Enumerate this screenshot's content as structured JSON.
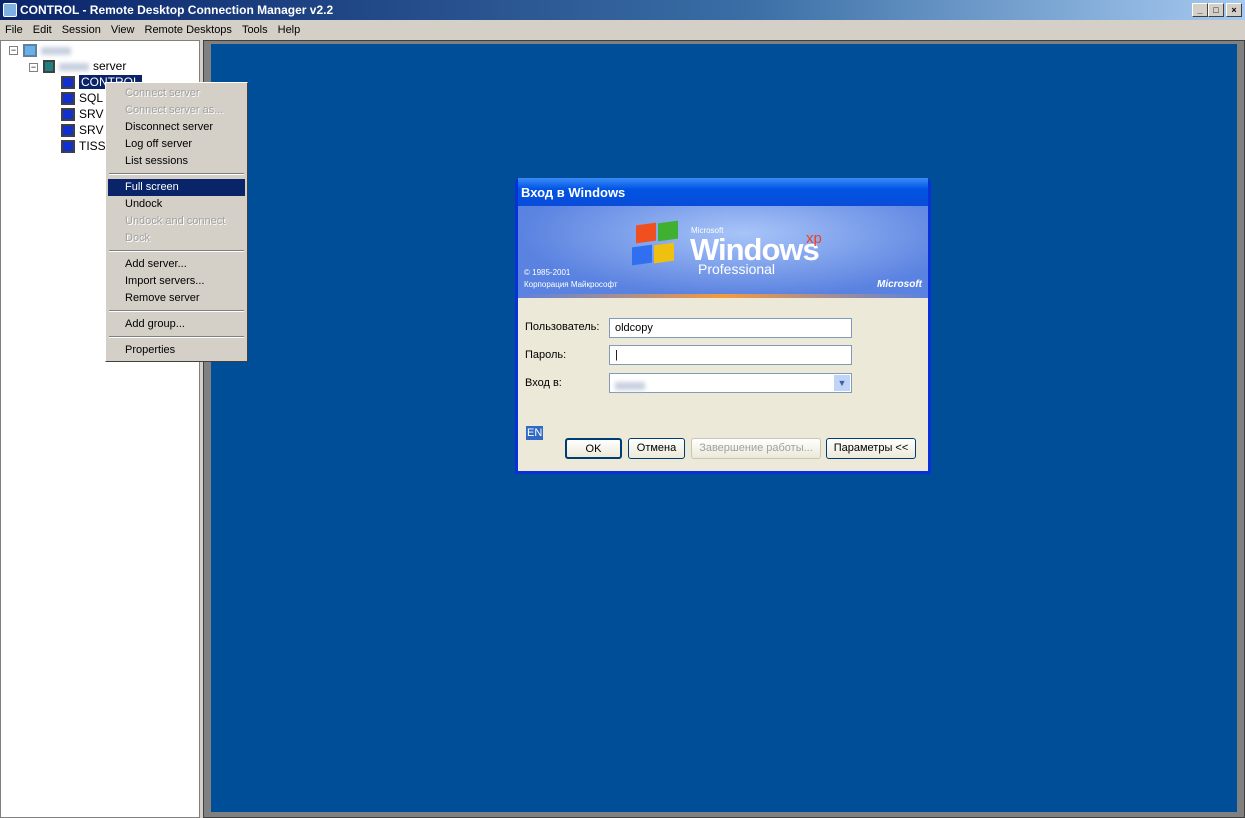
{
  "window": {
    "title": "CONTROL - Remote Desktop Connection Manager v2.2",
    "controls": [
      "_",
      "□",
      "×"
    ]
  },
  "menu": [
    "File",
    "Edit",
    "Session",
    "View",
    "Remote Desktops",
    "Tools",
    "Help"
  ],
  "tree": {
    "group_suffix": "server",
    "servers": [
      "CONTROL",
      "SQL",
      "SRV",
      "SRV",
      "TISS"
    ]
  },
  "context_menu": [
    {
      "label": "Connect server",
      "disabled": true
    },
    {
      "label": "Connect server as...",
      "disabled": true
    },
    {
      "label": "Disconnect server"
    },
    {
      "label": "Log off server"
    },
    {
      "label": "List sessions"
    },
    {
      "sep": true
    },
    {
      "label": "Full screen",
      "highlighted": true
    },
    {
      "label": "Undock"
    },
    {
      "label": "Undock and connect",
      "disabled": true
    },
    {
      "label": "Dock",
      "disabled": true
    },
    {
      "sep": true
    },
    {
      "label": "Add server..."
    },
    {
      "label": "Import servers..."
    },
    {
      "label": "Remove server"
    },
    {
      "sep": true
    },
    {
      "label": "Add group..."
    },
    {
      "sep": true
    },
    {
      "label": "Properties"
    }
  ],
  "login": {
    "title": "Вход в Windows",
    "brand": {
      "microsoft_small": "Microsoft",
      "windows": "Windows",
      "xp": "xp",
      "edition": "Professional",
      "copyright": "© 1985-2001",
      "corp": "Корпорация Майкрософт",
      "microsoft": "Microsoft"
    },
    "user_label": "Пользователь:",
    "user_value": "oldcopy",
    "password_label": "Пароль:",
    "password_value": "|",
    "domain_label": "Вход в:",
    "lang": "EN",
    "ok": "OK",
    "cancel": "Отмена",
    "shutdown": "Завершение работы...",
    "options": "Параметры <<"
  },
  "colors": {
    "desktop": "#004e98",
    "selection": "#0a246a",
    "xp_title": "#0054e3"
  }
}
